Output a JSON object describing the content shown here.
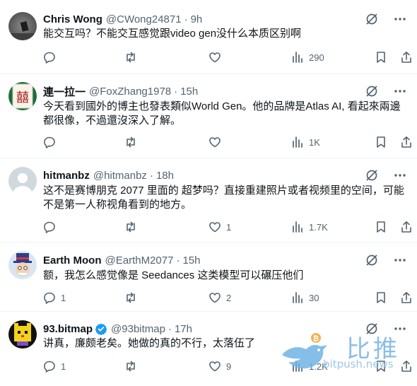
{
  "tweets": [
    {
      "name": "Chris Wong",
      "handle": "@CWong24871",
      "time": "9h",
      "text": "能交互吗？不能交互感觉跟video gen没什么本质区别啊",
      "replies": "",
      "retweets": "",
      "likes": "",
      "views": "290",
      "avatar_icon": "gray-photo-avatar"
    },
    {
      "name": "連一拉一",
      "handle": "@FoxZhang1978",
      "time": "15h",
      "text": "今天看到國外的博主也發表類似World Gen。他的品牌是Atlas AI, 看起來兩邊都很像，不過還沒深入了解。",
      "replies": "",
      "retweets": "",
      "likes": "",
      "views": "1K",
      "avatar_icon": "mahjong-tile-avatar"
    },
    {
      "name": "hitmanbz",
      "handle": "@hitmanbz",
      "time": "18h",
      "text": "这不是赛博朋克 2077 里面的 超梦吗？直接重建照片或者视频里的空间，可能不是第一人称视角看到的地方。",
      "replies": "",
      "retweets": "",
      "likes": "1",
      "views": "1.7K",
      "avatar_icon": "default-user-avatar"
    },
    {
      "name": "Earth Moon",
      "handle": "@EarthM2077",
      "time": "15h",
      "text": "额，我怎么感觉像是 Seedances 这类模型可以碾压他们",
      "replies": "1",
      "retweets": "",
      "likes": "2",
      "views": "30",
      "avatar_icon": "cartoon-uncle-sam-avatar"
    },
    {
      "name": "93.bitmap",
      "handle": "@93bitmap",
      "time": "17h",
      "text": "讲真，廉颇老矣。她做的真的不行，太落伍了",
      "replies": "1",
      "retweets": "",
      "likes": "9",
      "views": "1.2K",
      "verified": true,
      "avatar_icon": "pixel-cat-avatar"
    }
  ],
  "watermark": {
    "text": "比推",
    "url": "bitpush.news"
  },
  "colors": {
    "muted": "#536471",
    "text": "#0f1419",
    "verified": "#1d9bf0"
  }
}
